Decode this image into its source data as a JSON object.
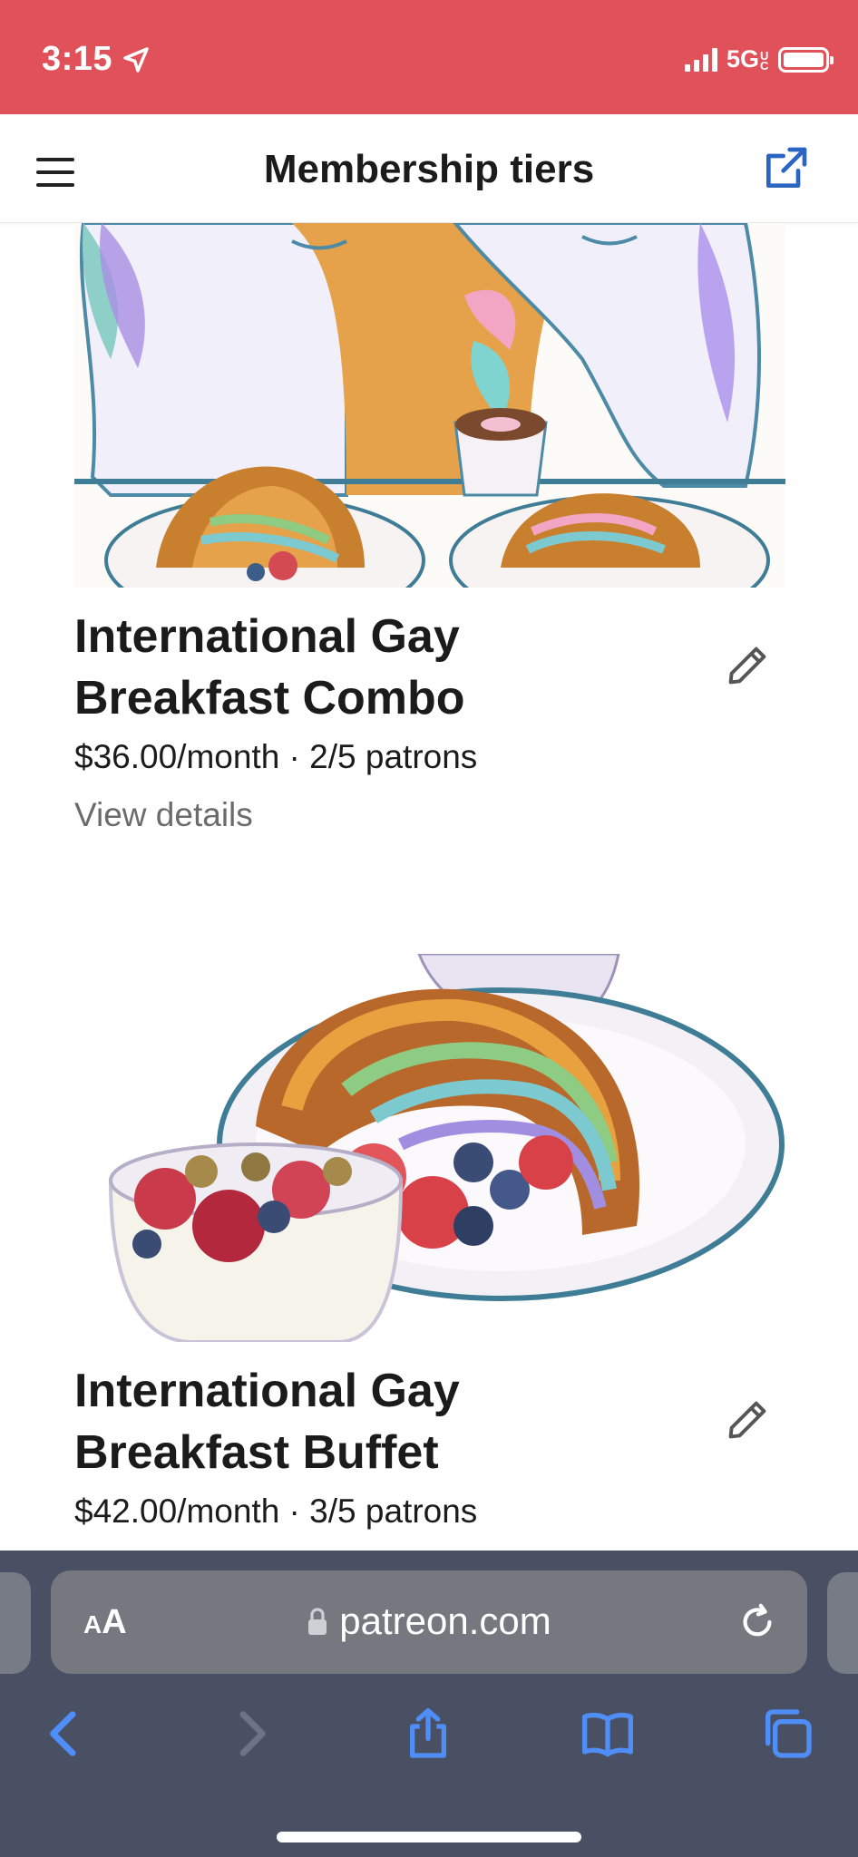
{
  "status_bar": {
    "time": "3:15",
    "network": "5G",
    "network_suffix": "UC",
    "background_color": "#e0515a"
  },
  "header": {
    "title": "Membership tiers",
    "menu_icon": "hamburger-menu-icon",
    "action_icon": "external-link-icon"
  },
  "tiers": [
    {
      "name": "International Gay Breakfast Combo",
      "name_line1": "International Gay",
      "name_line2": "Breakfast Combo",
      "meta": "$36.00/month · 2/5 patrons",
      "price": "$36.00/month",
      "patrons": "2/5 patrons",
      "details_link": "View details",
      "edit_icon": "pencil-icon"
    },
    {
      "name": "International Gay Breakfast Buffet",
      "name_line1": "International Gay",
      "name_line2": "Breakfast Buffet",
      "meta": "$42.00/month · 3/5 patrons",
      "price": "$42.00/month",
      "patrons": "3/5 patrons",
      "edit_icon": "pencil-icon"
    }
  ],
  "browser": {
    "aa_label_small": "A",
    "aa_label_big": "A",
    "url": "patreon.com",
    "background_color": "#4a5064",
    "accent_color": "#4f8ef7"
  }
}
